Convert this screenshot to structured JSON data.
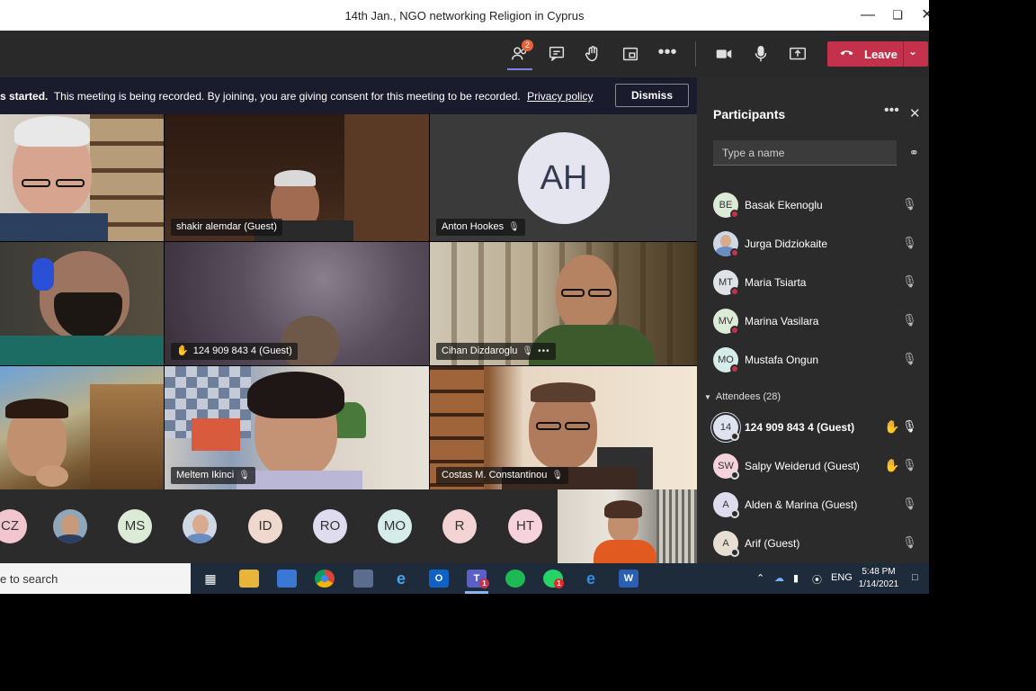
{
  "window": {
    "title": "14th Jan., NGO networking Religion in Cyprus"
  },
  "toolbar": {
    "participants_badge": "2",
    "leave_label": "Leave"
  },
  "banner": {
    "bold_text": "s started.",
    "text": "This meeting is being recorded. By joining, you are giving consent for this meeting to be recorded.",
    "link": "Privacy policy",
    "dismiss": "Dismiss"
  },
  "grid": {
    "tiles": [
      {
        "name": "shakir alemdar (Guest)"
      },
      {
        "name": "Anton Hookes",
        "initials": "AH"
      },
      {
        "name": "124 909 843 4 (Guest)"
      },
      {
        "name": "Cihan Dizdaroglu"
      },
      {
        "name": "Meltem Ikinci"
      },
      {
        "name": "Costas M. Constantinou"
      }
    ]
  },
  "strip": {
    "avatars": [
      {
        "initials": "CZ",
        "color": "#f2c6cf"
      },
      {
        "initials": "",
        "color": "#8fa7b8"
      },
      {
        "initials": "MS",
        "color": "#dcebd6"
      },
      {
        "initials": "",
        "color": "#cfd9e6"
      },
      {
        "initials": "ID",
        "color": "#efd9cf"
      },
      {
        "initials": "RO",
        "color": "#dfdcef"
      },
      {
        "initials": "MO",
        "color": "#d5eceb"
      },
      {
        "initials": "R",
        "color": "#f3d3d3"
      },
      {
        "initials": "HT",
        "color": "#f5d2dc"
      }
    ]
  },
  "panel": {
    "title": "Participants",
    "search_placeholder": "Type a name",
    "attendees_header": "Attendees (28)",
    "presenters": [
      {
        "initials": "BE",
        "name": "Basak Ekenoglu",
        "color": "#dcebd6"
      },
      {
        "initials": "",
        "name": "Jurga Didziokaite",
        "color": "#cfd9e6"
      },
      {
        "initials": "MT",
        "name": "Maria Tsiarta",
        "color": "#dfe2e6"
      },
      {
        "initials": "MV",
        "name": "Marina Vasilara",
        "color": "#dcebd6"
      },
      {
        "initials": "MO",
        "name": "Mustafa Ongun",
        "color": "#d5eceb"
      }
    ],
    "attendees": [
      {
        "initials": "14",
        "name": "124 909 843 4 (Guest)",
        "color": "#dfe2ef"
      },
      {
        "initials": "SW",
        "name": "Salpy Weiderud (Guest)",
        "color": "#f5d2dc"
      },
      {
        "initials": "A",
        "name": "Alden & Marina (Guest)",
        "color": "#dfdcef"
      },
      {
        "initials": "A",
        "name": "Arif (Guest)",
        "color": "#e7e0d2"
      }
    ]
  },
  "taskbar": {
    "search_text": "e to search",
    "lang": "ENG",
    "time": "5:48 PM",
    "date": "1/14/2021",
    "teams_badge": "1",
    "whatsapp_badge": "1"
  }
}
